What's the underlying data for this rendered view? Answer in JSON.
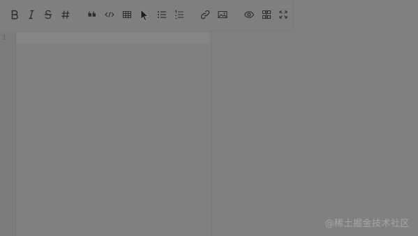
{
  "toolbar": {
    "buttons": [
      {
        "name": "bold-icon"
      },
      {
        "name": "italic-icon"
      },
      {
        "name": "strikethrough-icon"
      },
      {
        "name": "heading-icon"
      },
      {
        "name": "quote-icon"
      },
      {
        "name": "code-icon"
      },
      {
        "name": "table-icon"
      },
      {
        "name": "bulleted-list-icon"
      },
      {
        "name": "numbered-list-icon"
      },
      {
        "name": "link-icon"
      },
      {
        "name": "image-icon"
      },
      {
        "name": "preview-eye-icon"
      },
      {
        "name": "split-view-icon"
      },
      {
        "name": "fullscreen-icon"
      }
    ]
  },
  "editor": {
    "line_numbers": [
      "1"
    ]
  },
  "watermark": {
    "text": "@稀土掘金技术社区"
  },
  "colors": {
    "overlay_background": "#808080",
    "icon_color": "#2e2e2e"
  }
}
